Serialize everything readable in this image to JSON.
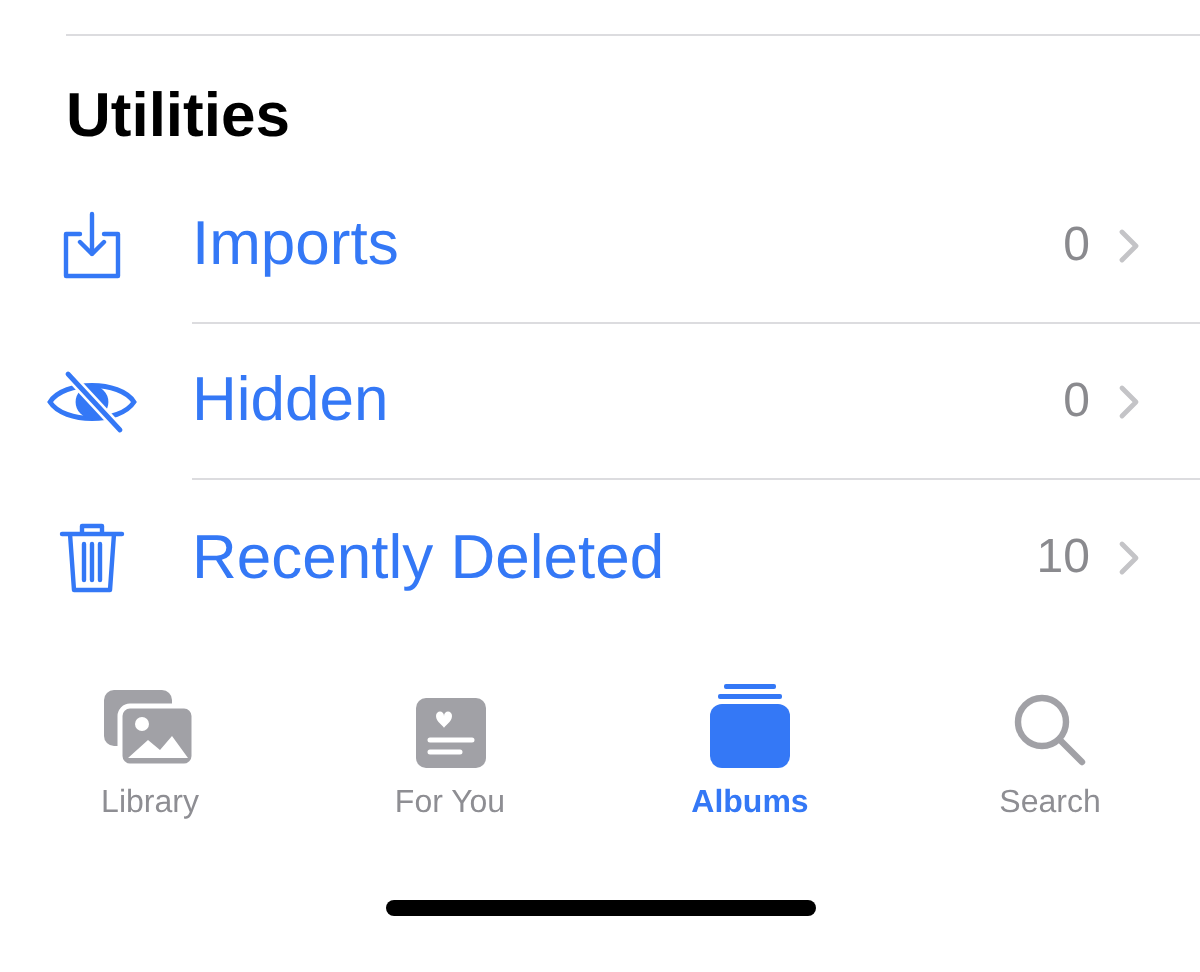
{
  "section": {
    "title": "Utilities"
  },
  "rows": [
    {
      "kind": "imports",
      "label": "Imports",
      "count": "0"
    },
    {
      "kind": "hidden",
      "label": "Hidden",
      "count": "0"
    },
    {
      "kind": "trash",
      "label": "Recently Deleted",
      "count": "10"
    }
  ],
  "tabs": [
    {
      "kind": "library",
      "label": "Library",
      "selected": false
    },
    {
      "kind": "for-you",
      "label": "For You",
      "selected": false
    },
    {
      "kind": "albums",
      "label": "Albums",
      "selected": true
    },
    {
      "kind": "search",
      "label": "Search",
      "selected": false
    }
  ]
}
